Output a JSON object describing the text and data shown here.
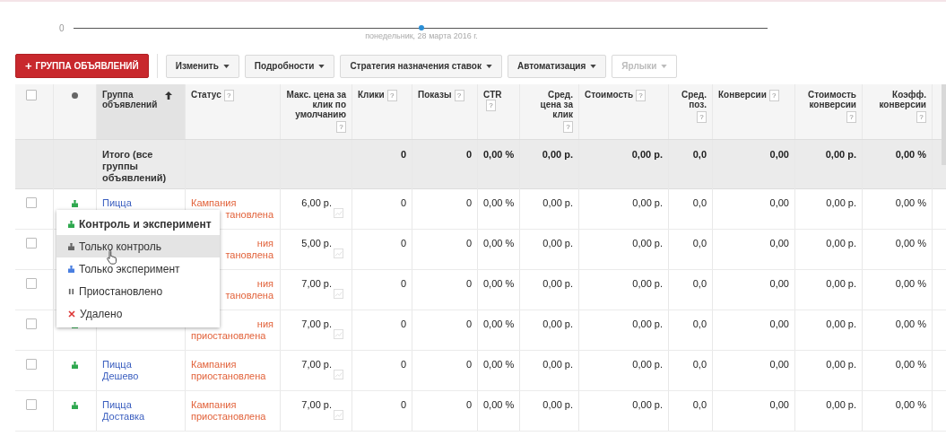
{
  "timeline": {
    "axis_label": "0",
    "date": "понедельник, 28 марта 2016 г."
  },
  "toolbar": {
    "add_button": {
      "icon": "+",
      "label": "ГРУППА ОБЪЯВЛЕНИЙ"
    },
    "menus": [
      {
        "label": "Изменить",
        "disabled": false
      },
      {
        "label": "Подробности",
        "disabled": false
      },
      {
        "label": "Стратегия назначения ставок",
        "disabled": false
      },
      {
        "label": "Автоматизация",
        "disabled": false
      },
      {
        "label": "Ярлыки",
        "disabled": true
      }
    ]
  },
  "table": {
    "header_checkbox": {
      "checked": false
    },
    "columns": [
      {
        "label": "Группа объявлений",
        "sorted": true
      },
      {
        "label": "Статус",
        "help": "?",
        "sorted": false
      },
      {
        "label": "Макс. цена за клик по умолчанию",
        "help": "?",
        "sorted": false
      },
      {
        "label": "Клики",
        "help": "?",
        "sorted": false
      },
      {
        "label": "Показы",
        "help": "?",
        "sorted": false
      },
      {
        "label": "CTR",
        "help": "?",
        "sorted": false
      },
      {
        "label": "Сред. цена за клик",
        "help": "?",
        "sorted": false
      },
      {
        "label": "Стоимость",
        "help": "?",
        "sorted": false
      },
      {
        "label": "Сред. поз.",
        "help": "?",
        "sorted": false
      },
      {
        "label": "Конверсии",
        "help": "?",
        "sorted": false
      },
      {
        "label": "Стоимость конверсии",
        "help": "?",
        "sorted": false
      },
      {
        "label": "Коэфф. конверсии",
        "help": "?",
        "sorted": false
      }
    ],
    "total": {
      "label": "Итого (все группы объявлений)",
      "values": [
        "0",
        "0",
        "0,00 %",
        "0,00 р.",
        "0,00 р.",
        "0,0",
        "0,00",
        "0,00 р.",
        "0,00 %"
      ]
    },
    "rows": [
      {
        "checked": false,
        "kind": "active",
        "group": [
          "Пицца"
        ],
        "status": [
          {
            "text": "Кампания",
            "cut": false
          },
          {
            "text": "тановлена",
            "cut": true
          }
        ],
        "bid": "6,00 р.",
        "values": [
          "0",
          "0",
          "0,00 %",
          "0,00 р.",
          "0,00 р.",
          "0,0",
          "0,00",
          "0,00 р.",
          "0,00 %"
        ]
      },
      {
        "checked": false,
        "kind": "hidden",
        "group": [],
        "status": [
          {
            "text": "ния",
            "cut": true
          },
          {
            "text": "тановлена",
            "cut": true
          }
        ],
        "bid": "5,00 р.",
        "values": [
          "0",
          "0",
          "0,00 %",
          "0,00 р.",
          "0,00 р.",
          "0,0",
          "0,00",
          "0,00 р.",
          "0,00 %"
        ]
      },
      {
        "checked": false,
        "kind": "hidden",
        "group": [],
        "status": [
          {
            "text": "ния",
            "cut": true
          },
          {
            "text": "тановлена",
            "cut": true
          }
        ],
        "bid": "7,00 р.",
        "values": [
          "0",
          "0",
          "0,00 %",
          "0,00 р.",
          "0,00 р.",
          "0,0",
          "0,00",
          "0,00 р.",
          "0,00 %"
        ]
      },
      {
        "checked": false,
        "kind": "active",
        "group": [],
        "status": [
          {
            "text": "ния",
            "cut": true
          },
          {
            "text": "приостановлена",
            "cut": false
          }
        ],
        "bid": "7,00 р.",
        "values": [
          "0",
          "0",
          "0,00 %",
          "0,00 р.",
          "0,00 р.",
          "0,0",
          "0,00",
          "0,00 р.",
          "0,00 %"
        ]
      },
      {
        "checked": false,
        "kind": "active",
        "group": [
          "Пицца",
          "Дешево"
        ],
        "status": [
          {
            "text": "Кампания",
            "cut": false
          },
          {
            "text": "приостановлена",
            "cut": false
          }
        ],
        "bid": "7,00 р.",
        "values": [
          "0",
          "0",
          "0,00 %",
          "0,00 р.",
          "0,00 р.",
          "0,0",
          "0,00",
          "0,00 р.",
          "0,00 %"
        ]
      },
      {
        "checked": false,
        "kind": "active",
        "group": [
          "Пицца",
          "Доставка"
        ],
        "status": [
          {
            "text": "Кампания",
            "cut": false
          },
          {
            "text": "приостановлена",
            "cut": false
          }
        ],
        "bid": "7,00 р.",
        "values": [
          "0",
          "0",
          "0,00 %",
          "0,00 р.",
          "0,00 р.",
          "0,0",
          "0,00",
          "0,00 р.",
          "0,00 %"
        ]
      }
    ]
  },
  "status_menu": {
    "items": [
      {
        "kind": "both",
        "label": "Контроль и эксперимент",
        "bold": true,
        "selected": false
      },
      {
        "kind": "control",
        "label": "Только контроль",
        "bold": false,
        "selected": true
      },
      {
        "kind": "experiment",
        "label": "Только эксперимент",
        "bold": false,
        "selected": false
      },
      {
        "kind": "paused",
        "label": "Приостановлено",
        "bold": false,
        "selected": false
      },
      {
        "kind": "removed",
        "label": "Удалено",
        "bold": false,
        "selected": false
      }
    ]
  }
}
